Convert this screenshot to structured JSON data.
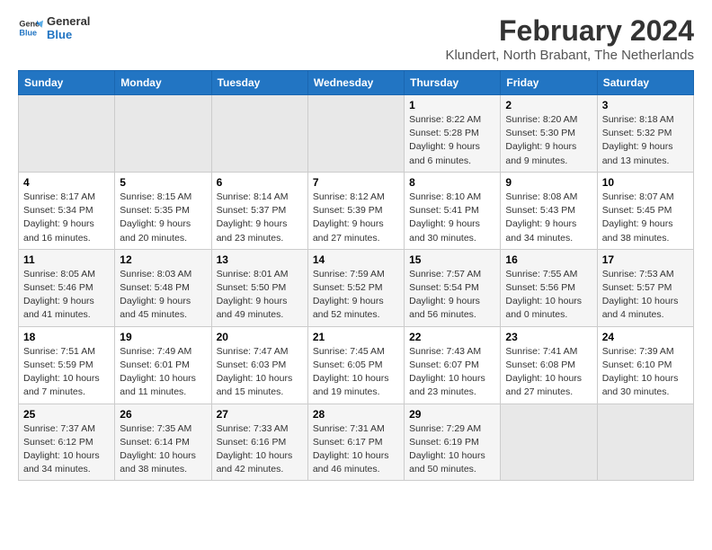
{
  "logo": {
    "line1": "General",
    "line2": "Blue"
  },
  "title": "February 2024",
  "subtitle": "Klundert, North Brabant, The Netherlands",
  "days_of_week": [
    "Sunday",
    "Monday",
    "Tuesday",
    "Wednesday",
    "Thursday",
    "Friday",
    "Saturday"
  ],
  "weeks": [
    [
      {
        "day": "",
        "info": ""
      },
      {
        "day": "",
        "info": ""
      },
      {
        "day": "",
        "info": ""
      },
      {
        "day": "",
        "info": ""
      },
      {
        "day": "1",
        "info": "Sunrise: 8:22 AM\nSunset: 5:28 PM\nDaylight: 9 hours\nand 6 minutes."
      },
      {
        "day": "2",
        "info": "Sunrise: 8:20 AM\nSunset: 5:30 PM\nDaylight: 9 hours\nand 9 minutes."
      },
      {
        "day": "3",
        "info": "Sunrise: 8:18 AM\nSunset: 5:32 PM\nDaylight: 9 hours\nand 13 minutes."
      }
    ],
    [
      {
        "day": "4",
        "info": "Sunrise: 8:17 AM\nSunset: 5:34 PM\nDaylight: 9 hours\nand 16 minutes."
      },
      {
        "day": "5",
        "info": "Sunrise: 8:15 AM\nSunset: 5:35 PM\nDaylight: 9 hours\nand 20 minutes."
      },
      {
        "day": "6",
        "info": "Sunrise: 8:14 AM\nSunset: 5:37 PM\nDaylight: 9 hours\nand 23 minutes."
      },
      {
        "day": "7",
        "info": "Sunrise: 8:12 AM\nSunset: 5:39 PM\nDaylight: 9 hours\nand 27 minutes."
      },
      {
        "day": "8",
        "info": "Sunrise: 8:10 AM\nSunset: 5:41 PM\nDaylight: 9 hours\nand 30 minutes."
      },
      {
        "day": "9",
        "info": "Sunrise: 8:08 AM\nSunset: 5:43 PM\nDaylight: 9 hours\nand 34 minutes."
      },
      {
        "day": "10",
        "info": "Sunrise: 8:07 AM\nSunset: 5:45 PM\nDaylight: 9 hours\nand 38 minutes."
      }
    ],
    [
      {
        "day": "11",
        "info": "Sunrise: 8:05 AM\nSunset: 5:46 PM\nDaylight: 9 hours\nand 41 minutes."
      },
      {
        "day": "12",
        "info": "Sunrise: 8:03 AM\nSunset: 5:48 PM\nDaylight: 9 hours\nand 45 minutes."
      },
      {
        "day": "13",
        "info": "Sunrise: 8:01 AM\nSunset: 5:50 PM\nDaylight: 9 hours\nand 49 minutes."
      },
      {
        "day": "14",
        "info": "Sunrise: 7:59 AM\nSunset: 5:52 PM\nDaylight: 9 hours\nand 52 minutes."
      },
      {
        "day": "15",
        "info": "Sunrise: 7:57 AM\nSunset: 5:54 PM\nDaylight: 9 hours\nand 56 minutes."
      },
      {
        "day": "16",
        "info": "Sunrise: 7:55 AM\nSunset: 5:56 PM\nDaylight: 10 hours\nand 0 minutes."
      },
      {
        "day": "17",
        "info": "Sunrise: 7:53 AM\nSunset: 5:57 PM\nDaylight: 10 hours\nand 4 minutes."
      }
    ],
    [
      {
        "day": "18",
        "info": "Sunrise: 7:51 AM\nSunset: 5:59 PM\nDaylight: 10 hours\nand 7 minutes."
      },
      {
        "day": "19",
        "info": "Sunrise: 7:49 AM\nSunset: 6:01 PM\nDaylight: 10 hours\nand 11 minutes."
      },
      {
        "day": "20",
        "info": "Sunrise: 7:47 AM\nSunset: 6:03 PM\nDaylight: 10 hours\nand 15 minutes."
      },
      {
        "day": "21",
        "info": "Sunrise: 7:45 AM\nSunset: 6:05 PM\nDaylight: 10 hours\nand 19 minutes."
      },
      {
        "day": "22",
        "info": "Sunrise: 7:43 AM\nSunset: 6:07 PM\nDaylight: 10 hours\nand 23 minutes."
      },
      {
        "day": "23",
        "info": "Sunrise: 7:41 AM\nSunset: 6:08 PM\nDaylight: 10 hours\nand 27 minutes."
      },
      {
        "day": "24",
        "info": "Sunrise: 7:39 AM\nSunset: 6:10 PM\nDaylight: 10 hours\nand 30 minutes."
      }
    ],
    [
      {
        "day": "25",
        "info": "Sunrise: 7:37 AM\nSunset: 6:12 PM\nDaylight: 10 hours\nand 34 minutes."
      },
      {
        "day": "26",
        "info": "Sunrise: 7:35 AM\nSunset: 6:14 PM\nDaylight: 10 hours\nand 38 minutes."
      },
      {
        "day": "27",
        "info": "Sunrise: 7:33 AM\nSunset: 6:16 PM\nDaylight: 10 hours\nand 42 minutes."
      },
      {
        "day": "28",
        "info": "Sunrise: 7:31 AM\nSunset: 6:17 PM\nDaylight: 10 hours\nand 46 minutes."
      },
      {
        "day": "29",
        "info": "Sunrise: 7:29 AM\nSunset: 6:19 PM\nDaylight: 10 hours\nand 50 minutes."
      },
      {
        "day": "",
        "info": ""
      },
      {
        "day": "",
        "info": ""
      }
    ]
  ]
}
